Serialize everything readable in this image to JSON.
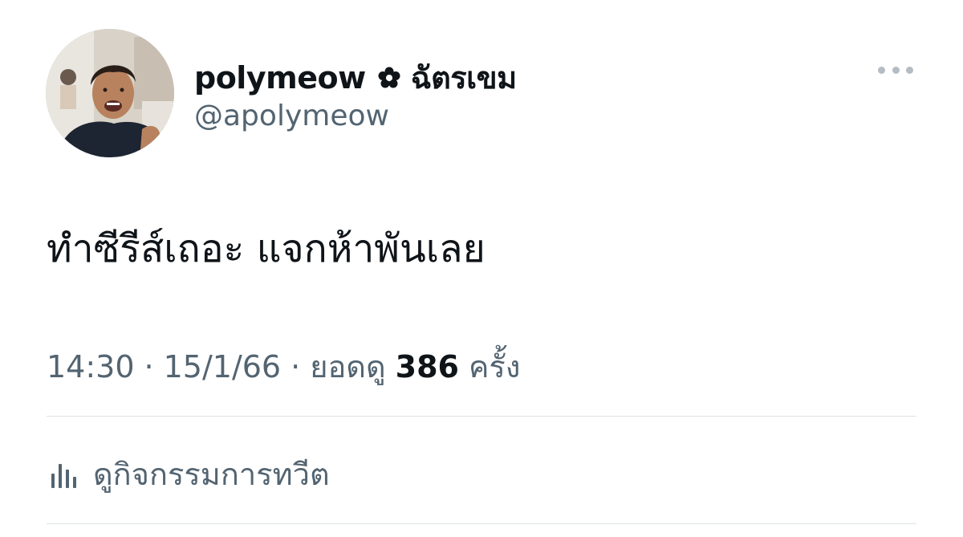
{
  "user": {
    "display_name": "polymeow",
    "display_name_suffix": "ฉัตรเขม",
    "name_icon": "flower-icon",
    "handle": "@apolymeow",
    "avatar_icon": "avatar-photo"
  },
  "tweet": {
    "text": "ทำซีรีส์เถอะ แจกห้าพันเลย"
  },
  "meta": {
    "time": "14:30",
    "separator": "·",
    "date": "15/1/66",
    "views_prefix": "ยอดดู",
    "views_count": "386",
    "views_suffix": "ครั้ง"
  },
  "actions": {
    "more_icon": "more-horizontal-icon",
    "activity_icon": "bar-chart-icon",
    "activity_label": "ดูกิจกรรมการทวีต"
  },
  "colors": {
    "primary_text": "#0f1419",
    "secondary_text": "#536471",
    "divider": "#dfe3e7",
    "more_dots": "#b4bcc4"
  }
}
